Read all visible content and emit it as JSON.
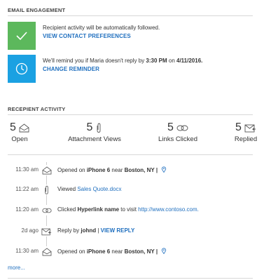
{
  "email_engagement": {
    "title": "EMAIL ENGAGEMENT",
    "follow_notice": {
      "message": "Recipient activity will be automatically followed.",
      "link": "VIEW CONTACT PREFERENCES",
      "tile_color": "#5cb85c",
      "icon": "checkmark-icon"
    },
    "reminder_notice": {
      "message_prefix": "We'll remind you if Maria doesn't reply by ",
      "time": "3:30 PM",
      "message_mid": " on ",
      "date": "4/11/2016.",
      "link": "CHANGE REMINDER",
      "tile_color": "#1ba1e2",
      "icon": "clock-icon"
    }
  },
  "recipient_activity": {
    "title": "RECEPIENT ACTIVITY",
    "stats": [
      {
        "count": "5",
        "label": "Open",
        "icon": "envelope-open-icon"
      },
      {
        "count": "5",
        "label": "Attachment Views",
        "icon": "paperclip-icon"
      },
      {
        "count": "5",
        "label": "Links Clicked",
        "icon": "link-icon"
      },
      {
        "count": "5",
        "label": "Replied",
        "icon": "reply-envelope-icon"
      }
    ],
    "timeline": [
      {
        "time": "11:30 am",
        "icon": "envelope-open-icon",
        "prefix": "Opened on ",
        "device": "iPhone 6",
        "near": " near ",
        "location": "Boston, NY",
        "sep": " |"
      },
      {
        "time": "11:22 am",
        "icon": "paperclip-icon",
        "prefix": "Viewed ",
        "file": "Sales Quote.docx"
      },
      {
        "time": "11:20 am",
        "icon": "link-icon",
        "prefix": "Clicked ",
        "link_name": "Hyperlink name",
        "mid": " to visit ",
        "url": "http://www.contoso.com."
      },
      {
        "time": "2d ago",
        "icon": "reply-envelope-icon",
        "prefix": "Reply by ",
        "user": "johnd",
        "sep": " | ",
        "action": "VIEW REPLY"
      },
      {
        "time": "11:30 am",
        "icon": "envelope-open-icon",
        "prefix": "Opened on ",
        "device": "iPhone 6",
        "near": " near ",
        "location": "Boston, NY",
        "sep": " |"
      }
    ],
    "more_link": "more..."
  }
}
